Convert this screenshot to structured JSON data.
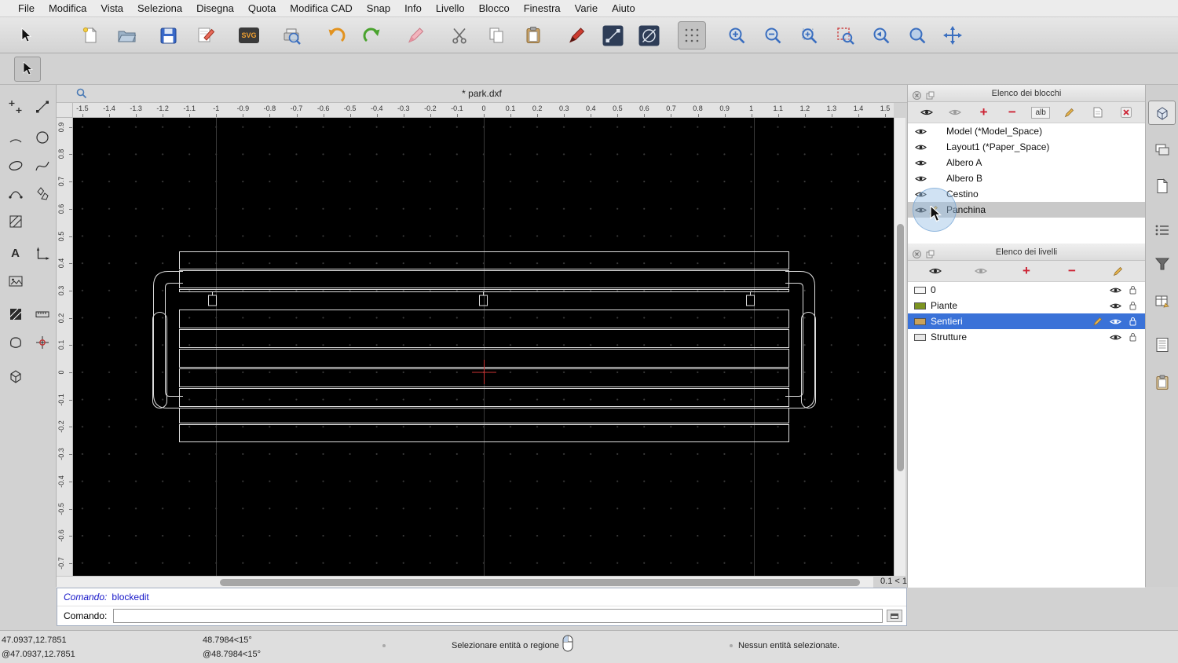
{
  "menubar": {
    "items": [
      "File",
      "Modifica",
      "Vista",
      "Seleziona",
      "Disegna",
      "Quota",
      "Modifica CAD",
      "Snap",
      "Info",
      "Livello",
      "Blocco",
      "Finestra",
      "Varie",
      "Aiuto"
    ]
  },
  "document": {
    "title": "* park.dxf"
  },
  "toolbar": {
    "svg_label": "SVG"
  },
  "palette": {
    "text_label": "A"
  },
  "rulers": {
    "h_labels": [
      "-1.5",
      "-1.4",
      "-1.3",
      "-1.2",
      "-1.1",
      "-1",
      "-0.9",
      "-0.8",
      "-0.7",
      "-0.6",
      "-0.5",
      "-0.4",
      "-0.3",
      "-0.2",
      "-0.1",
      "0",
      "0.1",
      "0.2",
      "0.3",
      "0.4",
      "0.5",
      "0.6",
      "0.7",
      "0.8",
      "0.9",
      "1",
      "1.1",
      "1.2",
      "1.3",
      "1.4",
      "1.5"
    ],
    "v_labels": [
      "0.9",
      "0.8",
      "0.7",
      "0.6",
      "0.5",
      "0.4",
      "0.3",
      "0.2",
      "0.1",
      "0",
      "-0.1",
      "-0.2",
      "-0.3",
      "-0.4",
      "-0.5",
      "-0.6",
      "-0.7"
    ]
  },
  "blocks_panel": {
    "title": "Elenco dei blocchi",
    "alb_label": "alb",
    "items": [
      {
        "label": "Model (*Model_Space)",
        "selected": false,
        "editing": false
      },
      {
        "label": "Layout1 (*Paper_Space)",
        "selected": false,
        "editing": false
      },
      {
        "label": "Albero A",
        "selected": false,
        "editing": false
      },
      {
        "label": "Albero B",
        "selected": false,
        "editing": false
      },
      {
        "label": "Cestino",
        "selected": false,
        "editing": false
      },
      {
        "label": "Panchina",
        "selected": true,
        "editing": true
      }
    ]
  },
  "layers_panel": {
    "title": "Elenco dei livelli",
    "items": [
      {
        "label": "0",
        "color": "#f7f7f7",
        "selected": false
      },
      {
        "label": "Piante",
        "color": "#7c941f",
        "selected": false
      },
      {
        "label": "Sentieri",
        "color": "#c9a25a",
        "selected": true
      },
      {
        "label": "Strutture",
        "color": "#e8e8e8",
        "selected": false
      }
    ]
  },
  "command": {
    "history_label": "Comando:",
    "history_value": "blockedit",
    "prompt_label": "Comando:",
    "input_value": ""
  },
  "scrollbar": {
    "zoom_indicator": "0.1 < 1"
  },
  "statusbar": {
    "abs_coord": "47.0937,12.7851",
    "rel_coord": "@47.0937,12.7851",
    "abs_angle": "48.7984<15°",
    "rel_angle": "@48.7984<15°",
    "hint": "Selezionare entità o regione",
    "selection": "Nessun entità selezionate."
  },
  "colors": {
    "selection_blue": "#3a72d8",
    "crosshair_red": "#cc3333",
    "canvas_black": "#000000"
  }
}
